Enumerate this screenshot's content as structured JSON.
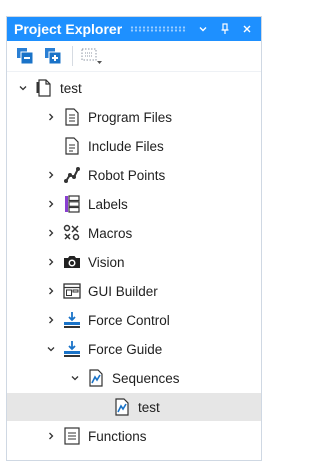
{
  "panel": {
    "title": "Project Explorer",
    "controls": [
      "dropdown-icon",
      "pin-icon",
      "close-icon"
    ]
  },
  "toolbar": {
    "buttons": [
      "collapse-all-icon",
      "new-item-icon",
      "view-options-icon"
    ]
  },
  "tree": {
    "root": {
      "label": "test",
      "expanded": true
    },
    "items": [
      {
        "label": "Program Files",
        "icon": "program-files-icon",
        "expandable": true,
        "expanded": false
      },
      {
        "label": "Include Files",
        "icon": "include-files-icon",
        "expandable": false
      },
      {
        "label": "Robot Points",
        "icon": "robot-points-icon",
        "expandable": true,
        "expanded": false
      },
      {
        "label": "Labels",
        "icon": "labels-icon",
        "expandable": true,
        "expanded": false
      },
      {
        "label": "Macros",
        "icon": "macros-icon",
        "expandable": true,
        "expanded": false
      },
      {
        "label": "Vision",
        "icon": "camera-icon",
        "expandable": true,
        "expanded": false
      },
      {
        "label": "GUI Builder",
        "icon": "gui-builder-icon",
        "expandable": true,
        "expanded": false
      },
      {
        "label": "Force Control",
        "icon": "force-control-icon",
        "expandable": true,
        "expanded": false
      },
      {
        "label": "Force Guide",
        "icon": "force-guide-icon",
        "expandable": true,
        "expanded": true
      },
      {
        "label": "Sequences",
        "icon": "sequences-icon",
        "expandable": true,
        "expanded": true
      },
      {
        "label": "test",
        "icon": "sequence-file-icon",
        "expandable": false,
        "selected": true
      },
      {
        "label": "Functions",
        "icon": "functions-icon",
        "expandable": true,
        "expanded": false
      }
    ]
  },
  "colors": {
    "titlebar": "#1e90ff",
    "selection": "#e6e6e6",
    "accent_blue": "#1a73c8"
  }
}
